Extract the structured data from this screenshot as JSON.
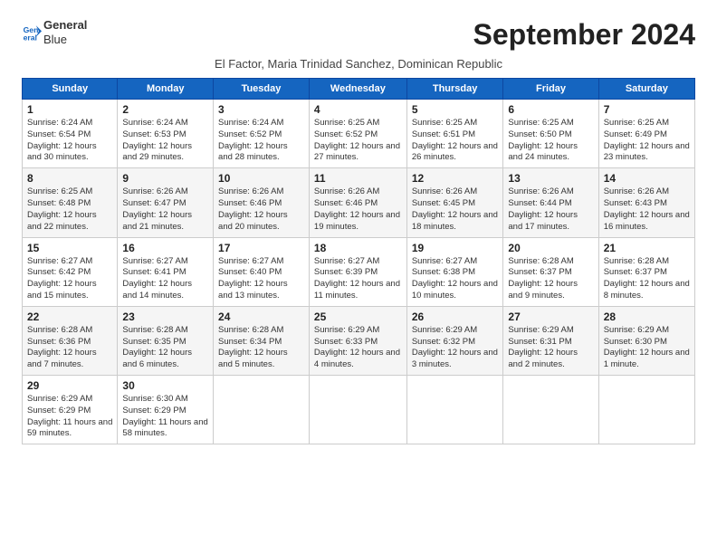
{
  "logo": {
    "line1": "General",
    "line2": "Blue"
  },
  "title": "September 2024",
  "subtitle": "El Factor, Maria Trinidad Sanchez, Dominican Republic",
  "days_of_week": [
    "Sunday",
    "Monday",
    "Tuesday",
    "Wednesday",
    "Thursday",
    "Friday",
    "Saturday"
  ],
  "weeks": [
    [
      {
        "day": "1",
        "sunrise": "Sunrise: 6:24 AM",
        "sunset": "Sunset: 6:54 PM",
        "daylight": "Daylight: 12 hours and 30 minutes."
      },
      {
        "day": "2",
        "sunrise": "Sunrise: 6:24 AM",
        "sunset": "Sunset: 6:53 PM",
        "daylight": "Daylight: 12 hours and 29 minutes."
      },
      {
        "day": "3",
        "sunrise": "Sunrise: 6:24 AM",
        "sunset": "Sunset: 6:52 PM",
        "daylight": "Daylight: 12 hours and 28 minutes."
      },
      {
        "day": "4",
        "sunrise": "Sunrise: 6:25 AM",
        "sunset": "Sunset: 6:52 PM",
        "daylight": "Daylight: 12 hours and 27 minutes."
      },
      {
        "day": "5",
        "sunrise": "Sunrise: 6:25 AM",
        "sunset": "Sunset: 6:51 PM",
        "daylight": "Daylight: 12 hours and 26 minutes."
      },
      {
        "day": "6",
        "sunrise": "Sunrise: 6:25 AM",
        "sunset": "Sunset: 6:50 PM",
        "daylight": "Daylight: 12 hours and 24 minutes."
      },
      {
        "day": "7",
        "sunrise": "Sunrise: 6:25 AM",
        "sunset": "Sunset: 6:49 PM",
        "daylight": "Daylight: 12 hours and 23 minutes."
      }
    ],
    [
      {
        "day": "8",
        "sunrise": "Sunrise: 6:25 AM",
        "sunset": "Sunset: 6:48 PM",
        "daylight": "Daylight: 12 hours and 22 minutes."
      },
      {
        "day": "9",
        "sunrise": "Sunrise: 6:26 AM",
        "sunset": "Sunset: 6:47 PM",
        "daylight": "Daylight: 12 hours and 21 minutes."
      },
      {
        "day": "10",
        "sunrise": "Sunrise: 6:26 AM",
        "sunset": "Sunset: 6:46 PM",
        "daylight": "Daylight: 12 hours and 20 minutes."
      },
      {
        "day": "11",
        "sunrise": "Sunrise: 6:26 AM",
        "sunset": "Sunset: 6:46 PM",
        "daylight": "Daylight: 12 hours and 19 minutes."
      },
      {
        "day": "12",
        "sunrise": "Sunrise: 6:26 AM",
        "sunset": "Sunset: 6:45 PM",
        "daylight": "Daylight: 12 hours and 18 minutes."
      },
      {
        "day": "13",
        "sunrise": "Sunrise: 6:26 AM",
        "sunset": "Sunset: 6:44 PM",
        "daylight": "Daylight: 12 hours and 17 minutes."
      },
      {
        "day": "14",
        "sunrise": "Sunrise: 6:26 AM",
        "sunset": "Sunset: 6:43 PM",
        "daylight": "Daylight: 12 hours and 16 minutes."
      }
    ],
    [
      {
        "day": "15",
        "sunrise": "Sunrise: 6:27 AM",
        "sunset": "Sunset: 6:42 PM",
        "daylight": "Daylight: 12 hours and 15 minutes."
      },
      {
        "day": "16",
        "sunrise": "Sunrise: 6:27 AM",
        "sunset": "Sunset: 6:41 PM",
        "daylight": "Daylight: 12 hours and 14 minutes."
      },
      {
        "day": "17",
        "sunrise": "Sunrise: 6:27 AM",
        "sunset": "Sunset: 6:40 PM",
        "daylight": "Daylight: 12 hours and 13 minutes."
      },
      {
        "day": "18",
        "sunrise": "Sunrise: 6:27 AM",
        "sunset": "Sunset: 6:39 PM",
        "daylight": "Daylight: 12 hours and 11 minutes."
      },
      {
        "day": "19",
        "sunrise": "Sunrise: 6:27 AM",
        "sunset": "Sunset: 6:38 PM",
        "daylight": "Daylight: 12 hours and 10 minutes."
      },
      {
        "day": "20",
        "sunrise": "Sunrise: 6:28 AM",
        "sunset": "Sunset: 6:37 PM",
        "daylight": "Daylight: 12 hours and 9 minutes."
      },
      {
        "day": "21",
        "sunrise": "Sunrise: 6:28 AM",
        "sunset": "Sunset: 6:37 PM",
        "daylight": "Daylight: 12 hours and 8 minutes."
      }
    ],
    [
      {
        "day": "22",
        "sunrise": "Sunrise: 6:28 AM",
        "sunset": "Sunset: 6:36 PM",
        "daylight": "Daylight: 12 hours and 7 minutes."
      },
      {
        "day": "23",
        "sunrise": "Sunrise: 6:28 AM",
        "sunset": "Sunset: 6:35 PM",
        "daylight": "Daylight: 12 hours and 6 minutes."
      },
      {
        "day": "24",
        "sunrise": "Sunrise: 6:28 AM",
        "sunset": "Sunset: 6:34 PM",
        "daylight": "Daylight: 12 hours and 5 minutes."
      },
      {
        "day": "25",
        "sunrise": "Sunrise: 6:29 AM",
        "sunset": "Sunset: 6:33 PM",
        "daylight": "Daylight: 12 hours and 4 minutes."
      },
      {
        "day": "26",
        "sunrise": "Sunrise: 6:29 AM",
        "sunset": "Sunset: 6:32 PM",
        "daylight": "Daylight: 12 hours and 3 minutes."
      },
      {
        "day": "27",
        "sunrise": "Sunrise: 6:29 AM",
        "sunset": "Sunset: 6:31 PM",
        "daylight": "Daylight: 12 hours and 2 minutes."
      },
      {
        "day": "28",
        "sunrise": "Sunrise: 6:29 AM",
        "sunset": "Sunset: 6:30 PM",
        "daylight": "Daylight: 12 hours and 1 minute."
      }
    ],
    [
      {
        "day": "29",
        "sunrise": "Sunrise: 6:29 AM",
        "sunset": "Sunset: 6:29 PM",
        "daylight": "Daylight: 11 hours and 59 minutes."
      },
      {
        "day": "30",
        "sunrise": "Sunrise: 6:30 AM",
        "sunset": "Sunset: 6:29 PM",
        "daylight": "Daylight: 11 hours and 58 minutes."
      },
      null,
      null,
      null,
      null,
      null
    ]
  ]
}
